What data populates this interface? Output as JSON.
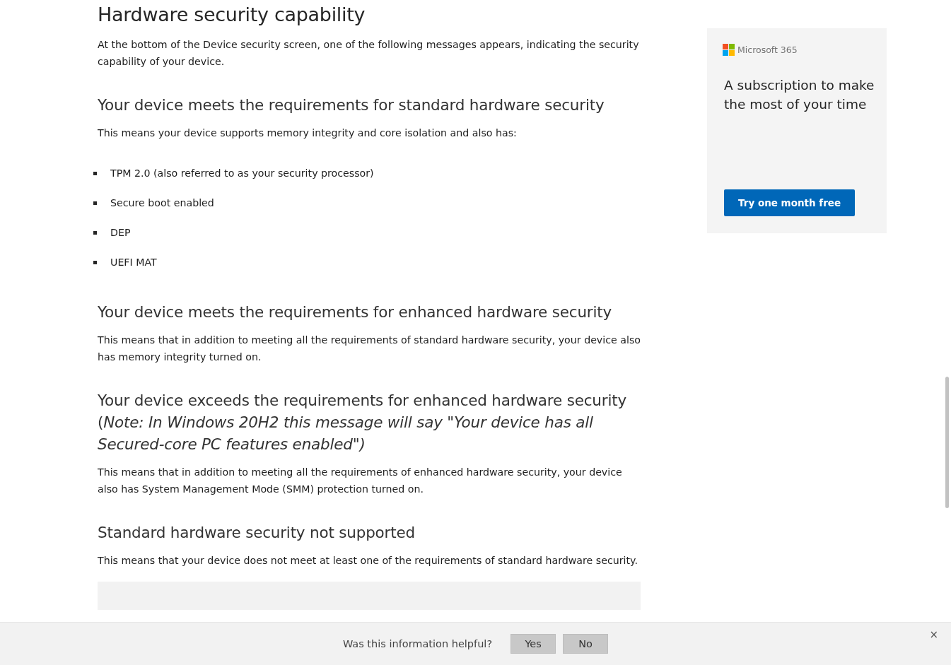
{
  "article": {
    "title": "Hardware security capability",
    "intro": "At the bottom of the Device security screen, one of the following messages appears, indicating the security capability of your device.",
    "sections": [
      {
        "heading": "Your device meets the requirements for standard hardware security",
        "paragraph": "This means your device supports memory integrity and core isolation and also has:",
        "bullets": [
          "TPM 2.0 (also referred to as your security processor)",
          "Secure boot enabled",
          "DEP",
          "UEFI MAT"
        ]
      },
      {
        "heading": "Your device meets the requirements for enhanced hardware security",
        "paragraph": "This means that in addition to meeting all the requirements of standard hardware security, your device also has memory integrity turned on."
      },
      {
        "heading": "Your device exceeds the requirements for enhanced hardware security (*Note: In Windows 20H2 this message will say \"Your device has all Secured-core PC features enabled\")*",
        "paragraph": "This means that in addition to meeting all the requirements of enhanced hardware security, your device also has System Management Mode (SMM) protection turned on."
      },
      {
        "heading": "Standard hardware security not supported",
        "paragraph": "This means that your device does not meet at least one of the requirements of standard hardware security."
      }
    ]
  },
  "ad": {
    "brand": "Microsoft 365",
    "headline": "A subscription to make the most of your time",
    "button": "Try one month free"
  },
  "feedback": {
    "question": "Was this information helpful?",
    "buttons": [
      "Yes",
      "No"
    ],
    "close": "×"
  }
}
